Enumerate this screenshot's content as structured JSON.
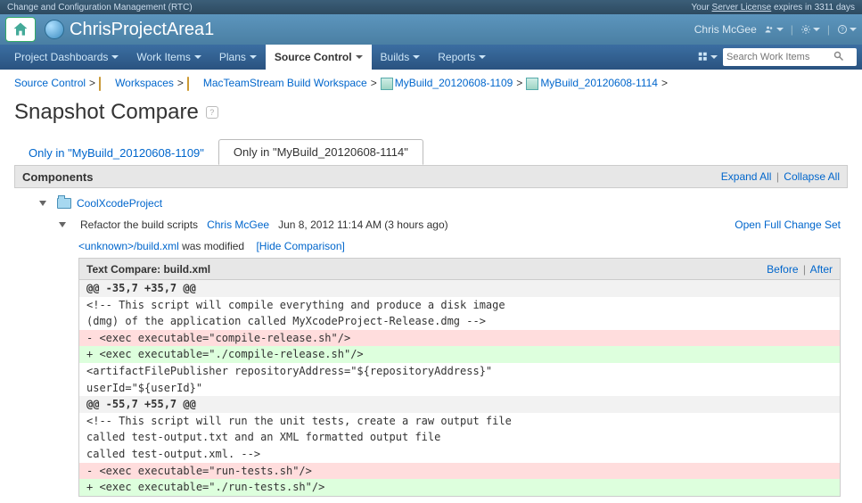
{
  "license_bar": {
    "left": "Change and Configuration Management (RTC)",
    "pre": "Your ",
    "link": "Server License",
    "post": " expires in 3311 days"
  },
  "header": {
    "project": "ChrisProjectArea1",
    "user": "Chris McGee"
  },
  "nav": {
    "items": [
      "Project Dashboards",
      "Work Items",
      "Plans",
      "Source Control",
      "Builds",
      "Reports"
    ],
    "active_idx": 3,
    "search_placeholder": "Search Work Items"
  },
  "breadcrumbs": {
    "items": [
      "Source Control",
      "Workspaces",
      "MacTeamStream Build Workspace",
      "MyBuild_20120608-1109",
      "MyBuild_20120608-1114"
    ]
  },
  "page": {
    "title": "Snapshot Compare"
  },
  "tabs": [
    {
      "label": "Only in \"MyBuild_20120608-1109\"",
      "active": false
    },
    {
      "label": "Only in \"MyBuild_20120608-1114\"",
      "active": true
    }
  ],
  "components_header": {
    "title": "Components",
    "expand": "Expand All",
    "collapse": "Collapse All"
  },
  "component": {
    "name": "CoolXcodeProject"
  },
  "changeset": {
    "summary": "Refactor the build scripts",
    "author": "Chris McGee",
    "date": "Jun 8, 2012 11:14 AM (3 hours ago)",
    "open_full": "Open Full Change Set"
  },
  "file_change": {
    "path_prefix": "<unknown>/build.xml",
    "status": " was modified",
    "hide_link": "[Hide Comparison]"
  },
  "diff": {
    "title": "Text Compare: build.xml",
    "before": "Before",
    "after": "After",
    "lines": [
      {
        "t": "hunk",
        "s": "@@ -35,7 +35,7 @@"
      },
      {
        "t": "ctx",
        "s": "<!-- This script will compile everything and produce a disk image"
      },
      {
        "t": "ctx",
        "s": "(dmg) of the application called MyXcodeProject-Release.dmg -->"
      },
      {
        "t": "del",
        "s": "- <exec executable=\"compile-release.sh\"/>"
      },
      {
        "t": "add",
        "s": "+ <exec executable=\"./compile-release.sh\"/>"
      },
      {
        "t": "ctx",
        "s": "<artifactFilePublisher repositoryAddress=\"${repositoryAddress}\""
      },
      {
        "t": "ctx",
        "s": "userId=\"${userId}\""
      },
      {
        "t": "hunk",
        "s": "@@ -55,7 +55,7 @@"
      },
      {
        "t": "ctx",
        "s": "<!-- This script will run the unit tests, create a raw output file"
      },
      {
        "t": "ctx",
        "s": "called test-output.txt and an XML formatted output file"
      },
      {
        "t": "ctx",
        "s": "called test-output.xml. -->"
      },
      {
        "t": "del",
        "s": "- <exec executable=\"run-tests.sh\"/>"
      },
      {
        "t": "add",
        "s": "+ <exec executable=\"./run-tests.sh\"/>"
      }
    ]
  }
}
